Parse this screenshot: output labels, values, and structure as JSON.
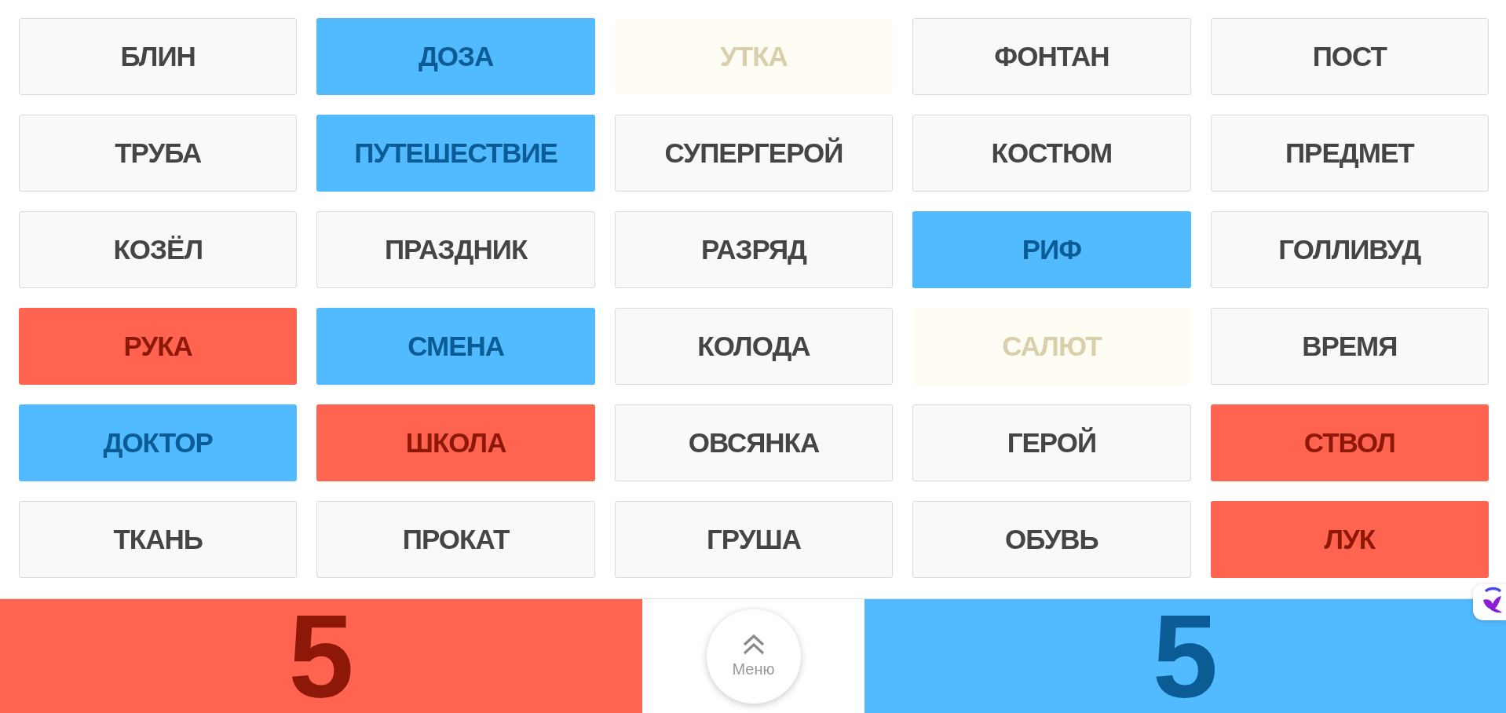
{
  "cards": [
    {
      "word": "БЛИН",
      "kind": "plain"
    },
    {
      "word": "ДОЗА",
      "kind": "blue"
    },
    {
      "word": "УТКА",
      "kind": "bystander"
    },
    {
      "word": "ФОНТАН",
      "kind": "plain"
    },
    {
      "word": "ПОСТ",
      "kind": "plain"
    },
    {
      "word": "ТРУБА",
      "kind": "plain"
    },
    {
      "word": "ПУТЕШЕСТВИЕ",
      "kind": "blue"
    },
    {
      "word": "СУПЕРГЕРОЙ",
      "kind": "plain"
    },
    {
      "word": "КОСТЮМ",
      "kind": "plain"
    },
    {
      "word": "ПРЕДМЕТ",
      "kind": "plain"
    },
    {
      "word": "КОЗЁЛ",
      "kind": "plain"
    },
    {
      "word": "ПРАЗДНИК",
      "kind": "plain"
    },
    {
      "word": "РАЗРЯД",
      "kind": "plain"
    },
    {
      "word": "РИФ",
      "kind": "blue"
    },
    {
      "word": "ГОЛЛИВУД",
      "kind": "plain"
    },
    {
      "word": "РУКА",
      "kind": "red"
    },
    {
      "word": "СМЕНА",
      "kind": "blue"
    },
    {
      "word": "КОЛОДА",
      "kind": "plain"
    },
    {
      "word": "САЛЮТ",
      "kind": "bystander"
    },
    {
      "word": "ВРЕМЯ",
      "kind": "plain"
    },
    {
      "word": "ДОКТОР",
      "kind": "blue"
    },
    {
      "word": "ШКОЛА",
      "kind": "red"
    },
    {
      "word": "ОВСЯНКА",
      "kind": "plain"
    },
    {
      "word": "ГЕРОЙ",
      "kind": "plain"
    },
    {
      "word": "СТВОЛ",
      "kind": "red"
    },
    {
      "word": "ТКАНЬ",
      "kind": "plain"
    },
    {
      "word": "ПРОКАТ",
      "kind": "plain"
    },
    {
      "word": "ГРУША",
      "kind": "plain"
    },
    {
      "word": "ОБУВЬ",
      "kind": "plain"
    },
    {
      "word": "ЛУК",
      "kind": "red"
    }
  ],
  "score_bar": {
    "red_score": "5",
    "menu_label": "Меню",
    "blue_score": "5"
  }
}
